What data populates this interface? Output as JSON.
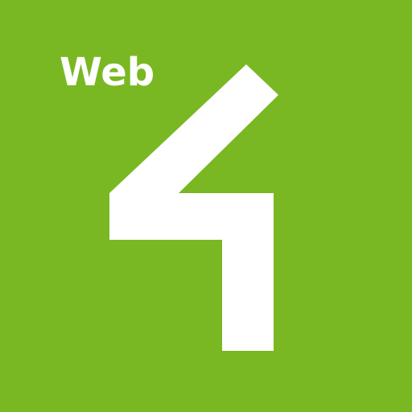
{
  "app_icon": {
    "label": "Web",
    "mark": "4",
    "icon": "numeral-four-logo-icon",
    "colors": {
      "background": "#79b823",
      "foreground": "#ffffff"
    }
  }
}
